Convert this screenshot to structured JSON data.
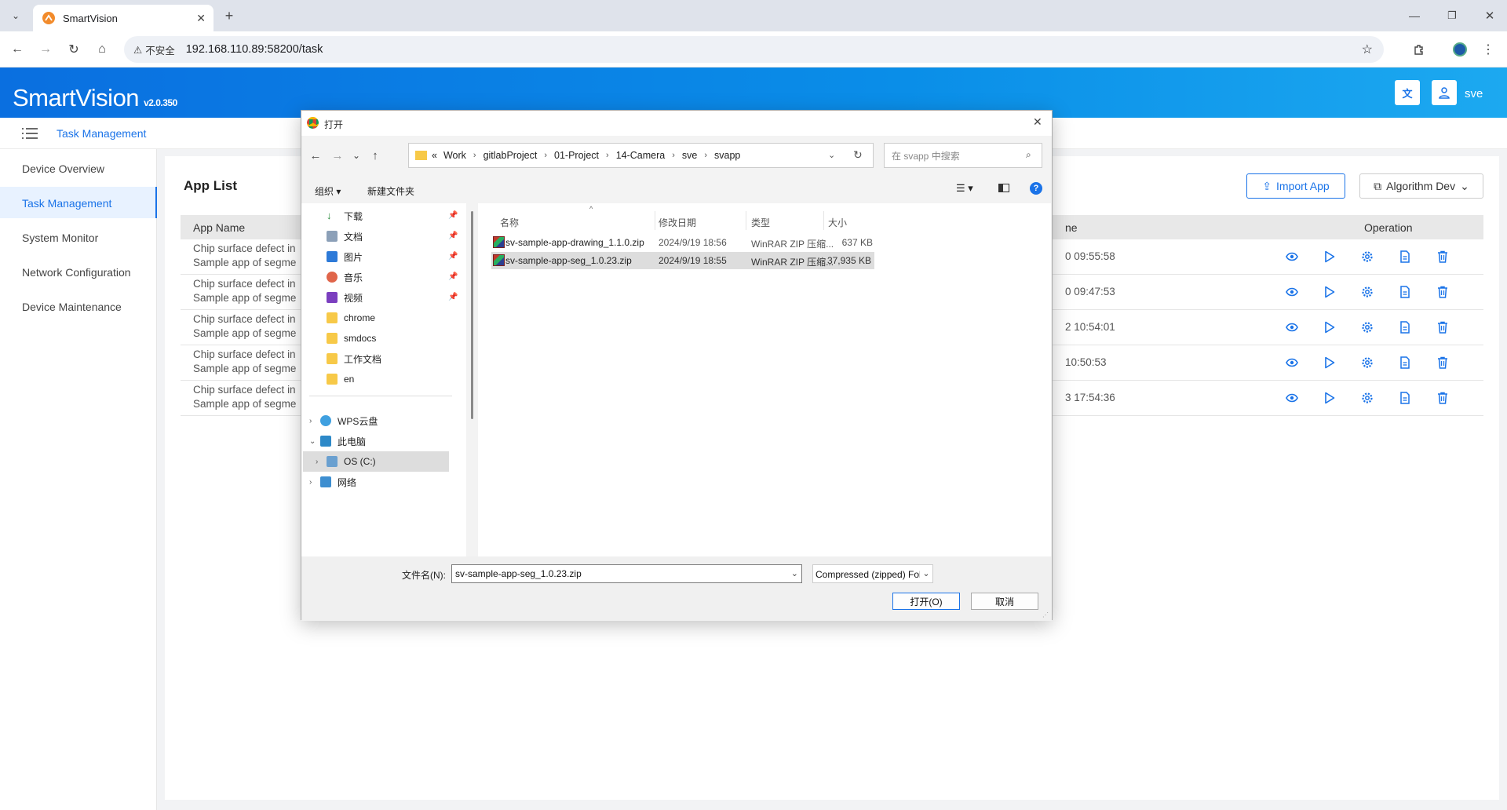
{
  "browser": {
    "tab_title": "SmartVision",
    "security_label": "不安全",
    "url": "192.168.110.89:58200/task"
  },
  "header": {
    "logo": "SmartVision",
    "version": "v2.0.350",
    "username": "sve"
  },
  "breadcrumb": "Task Management",
  "sidebar": {
    "items": [
      {
        "label": "Device Overview"
      },
      {
        "label": "Task Management"
      },
      {
        "label": "System Monitor"
      },
      {
        "label": "Network Configuration"
      },
      {
        "label": "Device Maintenance"
      }
    ],
    "active_index": 1
  },
  "main": {
    "title": "App List",
    "import_label": "Import App",
    "algo_label": "Algorithm Dev",
    "columns": {
      "name": "App Name",
      "time": "ne",
      "operation": "Operation"
    },
    "rows": [
      {
        "line1": "Chip surface defect in",
        "line2": "Sample app of segme",
        "time": "0 09:55:58"
      },
      {
        "line1": "Chip surface defect in",
        "line2": "Sample app of segme",
        "time": "0 09:47:53"
      },
      {
        "line1": "Chip surface defect in",
        "line2": "Sample app of segme",
        "time": "2 10:54:01"
      },
      {
        "line1": "Chip surface defect in",
        "line2": "Sample app of segme",
        "time": "10:50:53"
      },
      {
        "line1": "Chip surface defect in",
        "line2": "Sample app of segme",
        "time": "3 17:54:36"
      }
    ]
  },
  "dialog": {
    "title": "打开",
    "path_prefix": "«",
    "path": [
      "Work",
      "gitlabProject",
      "01-Project",
      "14-Camera",
      "sve",
      "svapp"
    ],
    "search_placeholder": "在 svapp 中搜索",
    "organize": "组织 ▾",
    "new_folder": "新建文件夹",
    "nav_items": [
      {
        "label": "下载",
        "icon": "download-icon"
      },
      {
        "label": "文档",
        "icon": "document-icon"
      },
      {
        "label": "图片",
        "icon": "picture-icon"
      },
      {
        "label": "音乐",
        "icon": "music-icon"
      },
      {
        "label": "视频",
        "icon": "video-icon"
      },
      {
        "label": "chrome",
        "icon": "folder-icon"
      },
      {
        "label": "smdocs",
        "icon": "folder-icon"
      },
      {
        "label": "工作文档",
        "icon": "folder-icon"
      },
      {
        "label": "en",
        "icon": "folder-icon"
      }
    ],
    "tree_items": [
      {
        "label": "WPS云盘"
      },
      {
        "label": "此电脑"
      },
      {
        "label": "OS (C:)"
      },
      {
        "label": "网络"
      }
    ],
    "file_headers": {
      "name": "名称",
      "date": "修改日期",
      "type": "类型",
      "size": "大小"
    },
    "files": [
      {
        "name": "sv-sample-app-drawing_1.1.0.zip",
        "date": "2024/9/19 18:56",
        "type": "WinRAR ZIP 压缩...",
        "size": "637 KB"
      },
      {
        "name": "sv-sample-app-seg_1.0.23.zip",
        "date": "2024/9/19 18:55",
        "type": "WinRAR ZIP 压缩...",
        "size": "37,935 KB"
      }
    ],
    "filename_label": "文件名(N):",
    "filename_value": "sv-sample-app-seg_1.0.23.zip",
    "filetype_value": "Compressed (zipped) Folder",
    "open_label": "打开(O)",
    "cancel_label": "取消"
  }
}
